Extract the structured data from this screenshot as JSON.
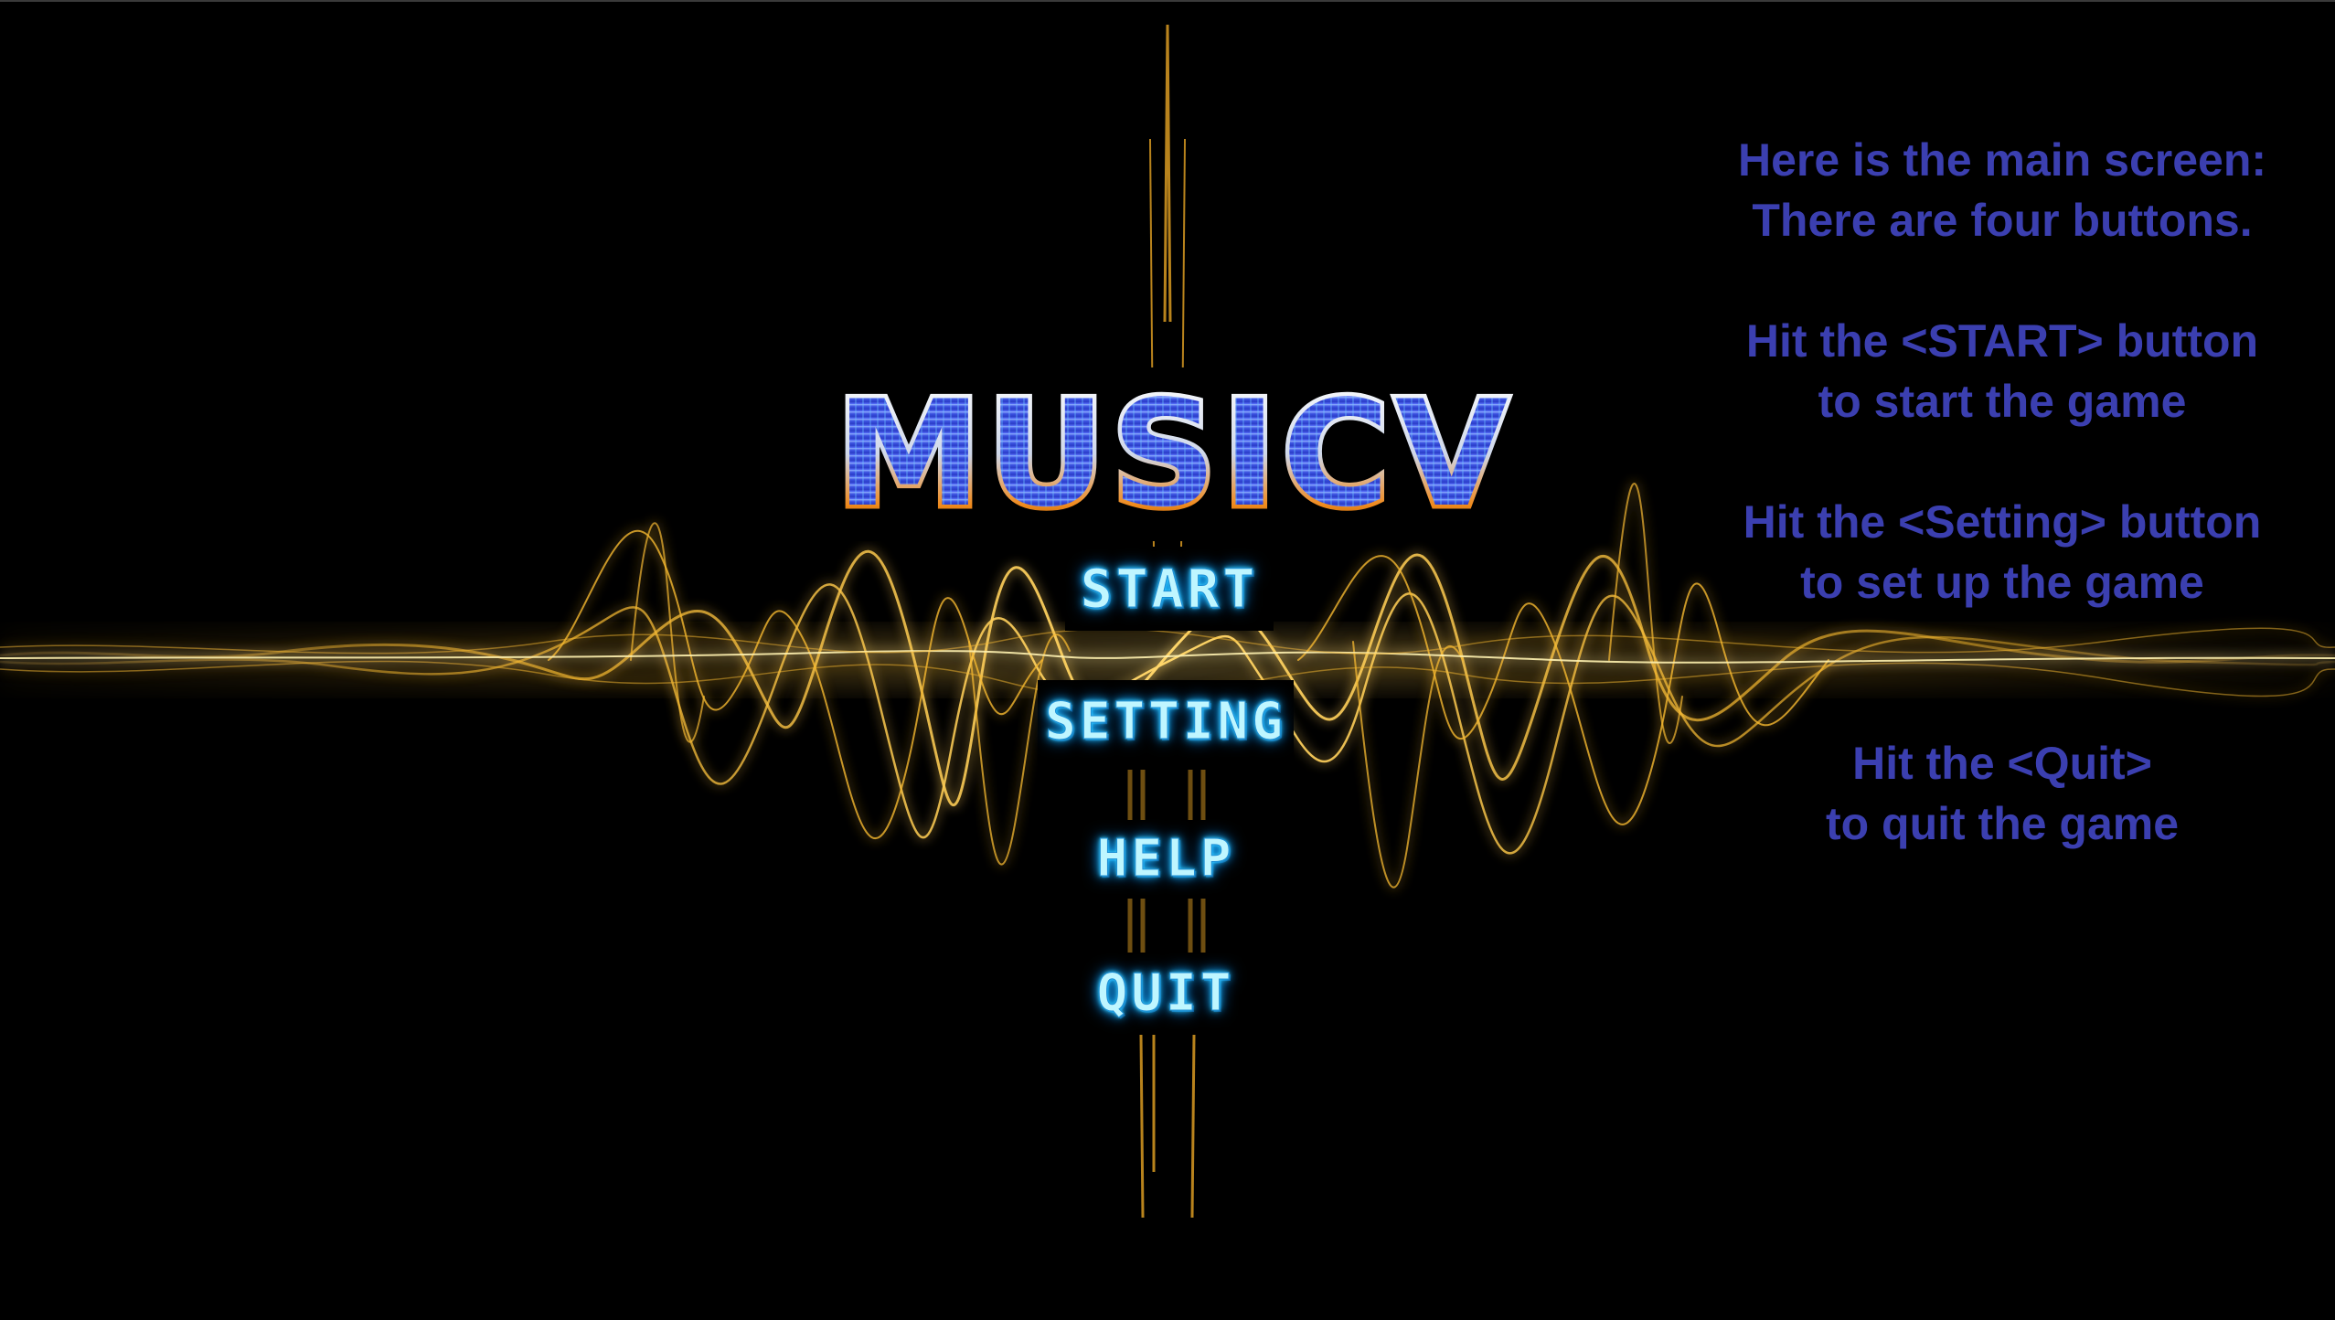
{
  "game": {
    "title": "MUSICV"
  },
  "menu": {
    "start_label": "START",
    "setting_label": "SETTING",
    "help_label": "HELP",
    "quit_label": "QUIT"
  },
  "instructions": {
    "intro_line1": "Here is the main screen:",
    "intro_line2": "There are four buttons.",
    "start_line1": "Hit the <START> button",
    "start_line2": "to start the game",
    "setting_line1": "Hit the <Setting> button",
    "setting_line2": "to set up the game",
    "quit_line1": "Hit the <Quit>",
    "quit_line2": "to quit the game"
  },
  "colors": {
    "background": "#000000",
    "wave_gold": "#f5b830",
    "wave_core": "#fff2b0",
    "button_neon": "#bff6ff",
    "button_glow": "#19b6ff",
    "instruction_text": "#3b3fb0",
    "logo_blue": "#3a4fe0",
    "logo_silver": "#e8eef8",
    "logo_orange": "#f08a1c"
  }
}
